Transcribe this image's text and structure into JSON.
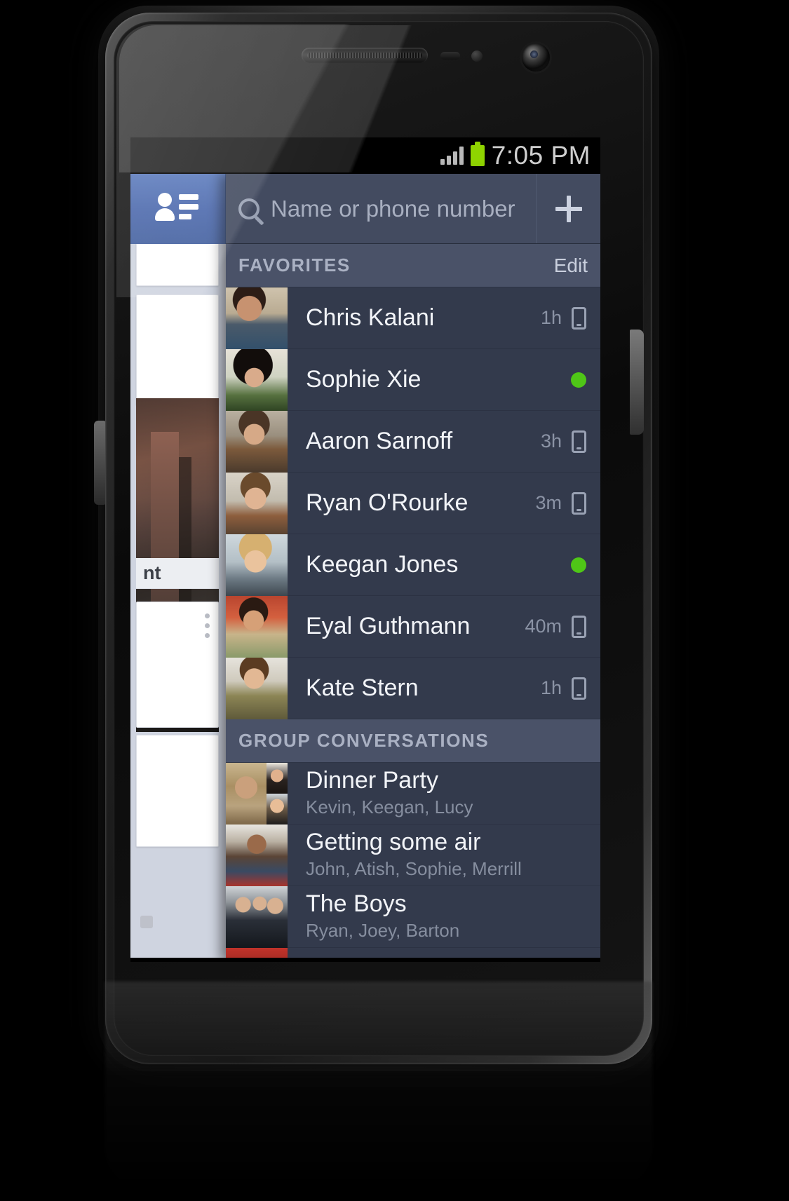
{
  "status_bar": {
    "time": "7:05 PM",
    "signal_icon": "signal-bars-icon",
    "battery_icon": "battery-full-icon"
  },
  "drawer_tab": {
    "icon": "contacts-list-icon",
    "accent_color": "#4c69ad"
  },
  "search": {
    "placeholder": "Name or phone number",
    "value": "",
    "icon": "search-icon",
    "add_label": "+",
    "add_icon": "plus-icon"
  },
  "sections": {
    "favorites": {
      "title": "FAVORITES",
      "action_label": "Edit"
    },
    "groups": {
      "title": "GROUP CONVERSATIONS"
    }
  },
  "favorites": [
    {
      "name": "Chris Kalani",
      "time": "1h",
      "status": "mobile",
      "avatar_class": "a-chris"
    },
    {
      "name": "Sophie Xie",
      "time": "",
      "status": "online",
      "avatar_class": "a-sophie"
    },
    {
      "name": "Aaron Sarnoff",
      "time": "3h",
      "status": "mobile",
      "avatar_class": "a-aaron"
    },
    {
      "name": "Ryan O'Rourke",
      "time": "3m",
      "status": "mobile",
      "avatar_class": "a-ryan"
    },
    {
      "name": "Keegan Jones",
      "time": "",
      "status": "online",
      "avatar_class": "a-keegan"
    },
    {
      "name": "Eyal Guthmann",
      "time": "40m",
      "status": "mobile",
      "avatar_class": "a-eyal"
    },
    {
      "name": "Kate Stern",
      "time": "1h",
      "status": "mobile",
      "avatar_class": "a-kate"
    }
  ],
  "groups": [
    {
      "name": "Dinner Party",
      "members": "Kevin, Keegan, Lucy",
      "avatar_kind": "composite"
    },
    {
      "name": "Getting some air",
      "members": "John, Atish, Sophie, Merrill",
      "avatar_kind": "single"
    },
    {
      "name": "The Boys",
      "members": "Ryan, Joey, Barton",
      "avatar_kind": "single"
    },
    {
      "name": "",
      "members": "",
      "avatar_kind": "single"
    }
  ],
  "background_feed": {
    "visible_text": "nt",
    "overflow_icon": "overflow-menu-icon"
  },
  "colors": {
    "panel_bg": "#343b4d",
    "row_bg": "#333a4c",
    "section_bg": "#4a5268",
    "search_bg": "#434b60",
    "accent_blue": "#4c69ad",
    "online_green": "#4fc617",
    "battery_green": "#8fd400"
  }
}
